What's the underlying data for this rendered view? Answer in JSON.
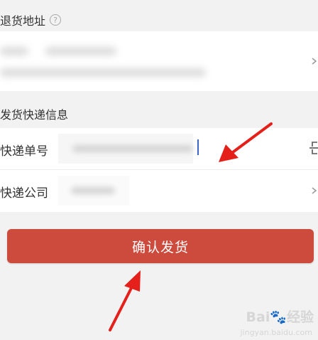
{
  "return_address": {
    "title": "退货地址",
    "help_icon": "help-circle-icon",
    "chevron_icon": "chevron-right-icon"
  },
  "express_info": {
    "title": "发货快递信息",
    "tracking_number_label": "快递单号",
    "courier_company_label": "快递公司",
    "scan_icon": "scan-icon",
    "chevron_icon": "chevron-right-icon"
  },
  "submit": {
    "label": "确认发货"
  },
  "watermark": {
    "text": "Bai🐾经验",
    "subtext": "jingyan.baidu.com"
  },
  "colors": {
    "button": "#cd4b3d",
    "arrow": "#e5201a",
    "background": "#f2f2f2"
  }
}
